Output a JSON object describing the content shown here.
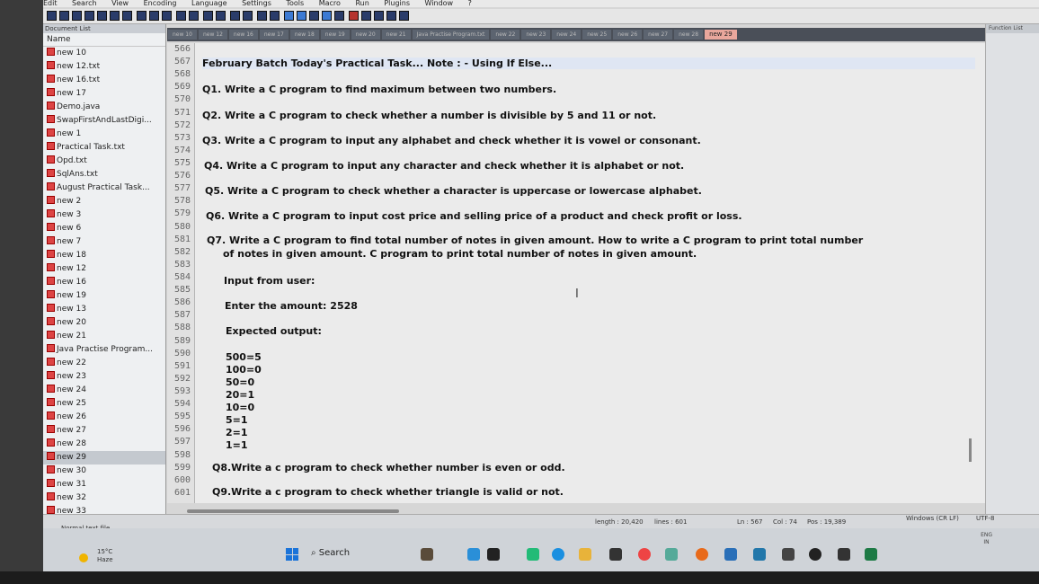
{
  "menubar": {
    "items": [
      "Edit",
      "Search",
      "View",
      "Encoding",
      "Language",
      "Settings",
      "Tools",
      "Macro",
      "Run",
      "Plugins",
      "Window",
      "?"
    ]
  },
  "doclist": {
    "title": "Document List",
    "column": "Name",
    "items": [
      "new 10",
      "new 12.txt",
      "new 16.txt",
      "new 17",
      "Demo.java",
      "SwapFirstAndLastDigi...",
      "new 1",
      "Practical Task.txt",
      "Opd.txt",
      "SqlAns.txt",
      "August Practical Task...",
      "new 2",
      "new 3",
      "new 6",
      "new 7",
      "new 18",
      "new 12",
      "new 16",
      "new 19",
      "new 13",
      "new 20",
      "new 21",
      "Java Practise Program...",
      "new 22",
      "new 23",
      "new 24",
      "new 25",
      "new 26",
      "new 27",
      "new 28",
      "new 29",
      "new 30",
      "new 31",
      "new 32",
      "new 33"
    ],
    "selected_index": 30
  },
  "tabs": {
    "items": [
      "new 10",
      "new 12",
      "new 16",
      "new 17",
      "new 18",
      "new 19",
      "new 20",
      "new 21",
      "Java Practise Program.txt",
      "new 22",
      "new 23",
      "new 24",
      "new 25",
      "new 26",
      "new 27",
      "new 28",
      "new 29"
    ],
    "active": "new 29"
  },
  "function_list": {
    "title": "Function List"
  },
  "editor": {
    "line_numbers": [
      "566",
      "567",
      "568",
      "569",
      "570",
      "571",
      "572",
      "573",
      "574",
      "575",
      "576",
      "577",
      "578",
      "579",
      "580",
      "581",
      "582",
      "583",
      "584",
      "585",
      "586",
      "587",
      "588",
      "589",
      "590",
      "591",
      "592",
      "593",
      "594",
      "595",
      "596",
      "597",
      "598",
      "599",
      "600",
      "601"
    ],
    "lines": {
      "l567": "February Batch Today's Practical Task...     Note : - Using If Else...",
      "l569": "Q1. Write a C program to find maximum between two numbers.",
      "l571": "Q2. Write a C program to check whether a number is divisible by 5 and 11 or not.",
      "l573": "Q3. Write a C program to input any alphabet and check whether it is vowel or consonant.",
      "l575": "Q4. Write a C program to input any character and check whether it is alphabet or not.",
      "l577": "Q5. Write a C program to check whether a character is uppercase or lowercase alphabet.",
      "l579": "Q6. Write a C program to input cost price and selling price of a product and check profit or loss.",
      "l581": "Q7. Write a C program to find total number of notes in given amount. How to write a C program to print total number",
      "l582": "of notes in given amount. C program to print total number of notes in given amount.",
      "l584": "Input from user:",
      "l586": "Enter the amount: 2528",
      "l588": "Expected output:",
      "l590": "500=5",
      "l591": "100=0",
      "l592": "50=0",
      "l593": "20=1",
      "l594": "10=0",
      "l595": "5=1",
      "l596": "2=1",
      "l597": "1=1",
      "l599": "Q8.Write a c program to check whether number is even or odd.",
      "l601": "Q9.Write a c program to check whether triangle is valid or not."
    }
  },
  "statusbar": {
    "file_type": "Normal text file",
    "length": "length : 20,420",
    "lines": "lines : 601",
    "ln": "Ln : 567",
    "col": "Col : 74",
    "pos": "Pos : 19,389",
    "eol": "Windows (CR LF)",
    "encoding": "UTF-8"
  },
  "taskbar": {
    "temperature": "15°C",
    "weather": "Haze",
    "search": "Search",
    "lang": "ENG",
    "region": "IN"
  }
}
